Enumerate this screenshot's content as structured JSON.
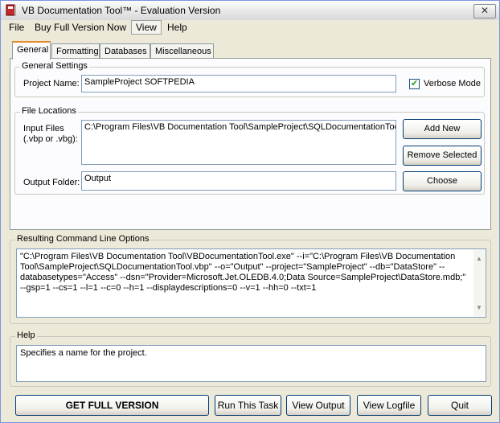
{
  "window": {
    "title": "VB Documentation Tool™ - Evaluation Version",
    "close_glyph": "✕"
  },
  "menu": [
    "File",
    "Buy Full Version Now",
    "View",
    "Help"
  ],
  "tabs": [
    "General",
    "Formatting",
    "Databases",
    "Miscellaneous"
  ],
  "general_settings": {
    "group_label": "General Settings",
    "project_name_label": "Project Name:",
    "project_name_value": "SampleProject SOFTPEDIA",
    "verbose_label": "Verbose Mode",
    "verbose_checked": true
  },
  "file_locations": {
    "group_label": "File Locations",
    "input_files_label_line1": "Input Files",
    "input_files_label_line2": "(.vbp or .vbg):",
    "input_files_value": "C:\\Program Files\\VB Documentation Tool\\SampleProject\\SQLDocumentationTool.vbp",
    "output_folder_label": "Output Folder:",
    "output_folder_value": "Output",
    "add_new": "Add New",
    "remove_selected": "Remove Selected",
    "choose": "Choose"
  },
  "command_line": {
    "group_label": "Resulting Command Line Options",
    "text": "\"C:\\Program Files\\VB Documentation Tool\\VBDocumentationTool.exe\" --i=\"C:\\Program Files\\VB Documentation Tool\\SampleProject\\SQLDocumentationTool.vbp\" --o=\"Output\" --project=\"SampleProject\" --db=\"DataStore\" --databasetypes=\"Access\" --dsn=\"Provider=Microsoft.Jet.OLEDB.4.0;Data Source=SampleProject\\DataStore.mdb;\" --gsp=1 --cs=1 --l=1 --c=0 --h=1 --displaydescriptions=0 --v=1 --hh=0 --txt=1"
  },
  "help": {
    "group_label": "Help",
    "text": "Specifies a name for the project."
  },
  "buttons": {
    "get_full_version": "GET FULL VERSION",
    "run_task": "Run This Task",
    "view_output": "View Output",
    "view_logfile": "View Logfile",
    "quit": "Quit"
  }
}
